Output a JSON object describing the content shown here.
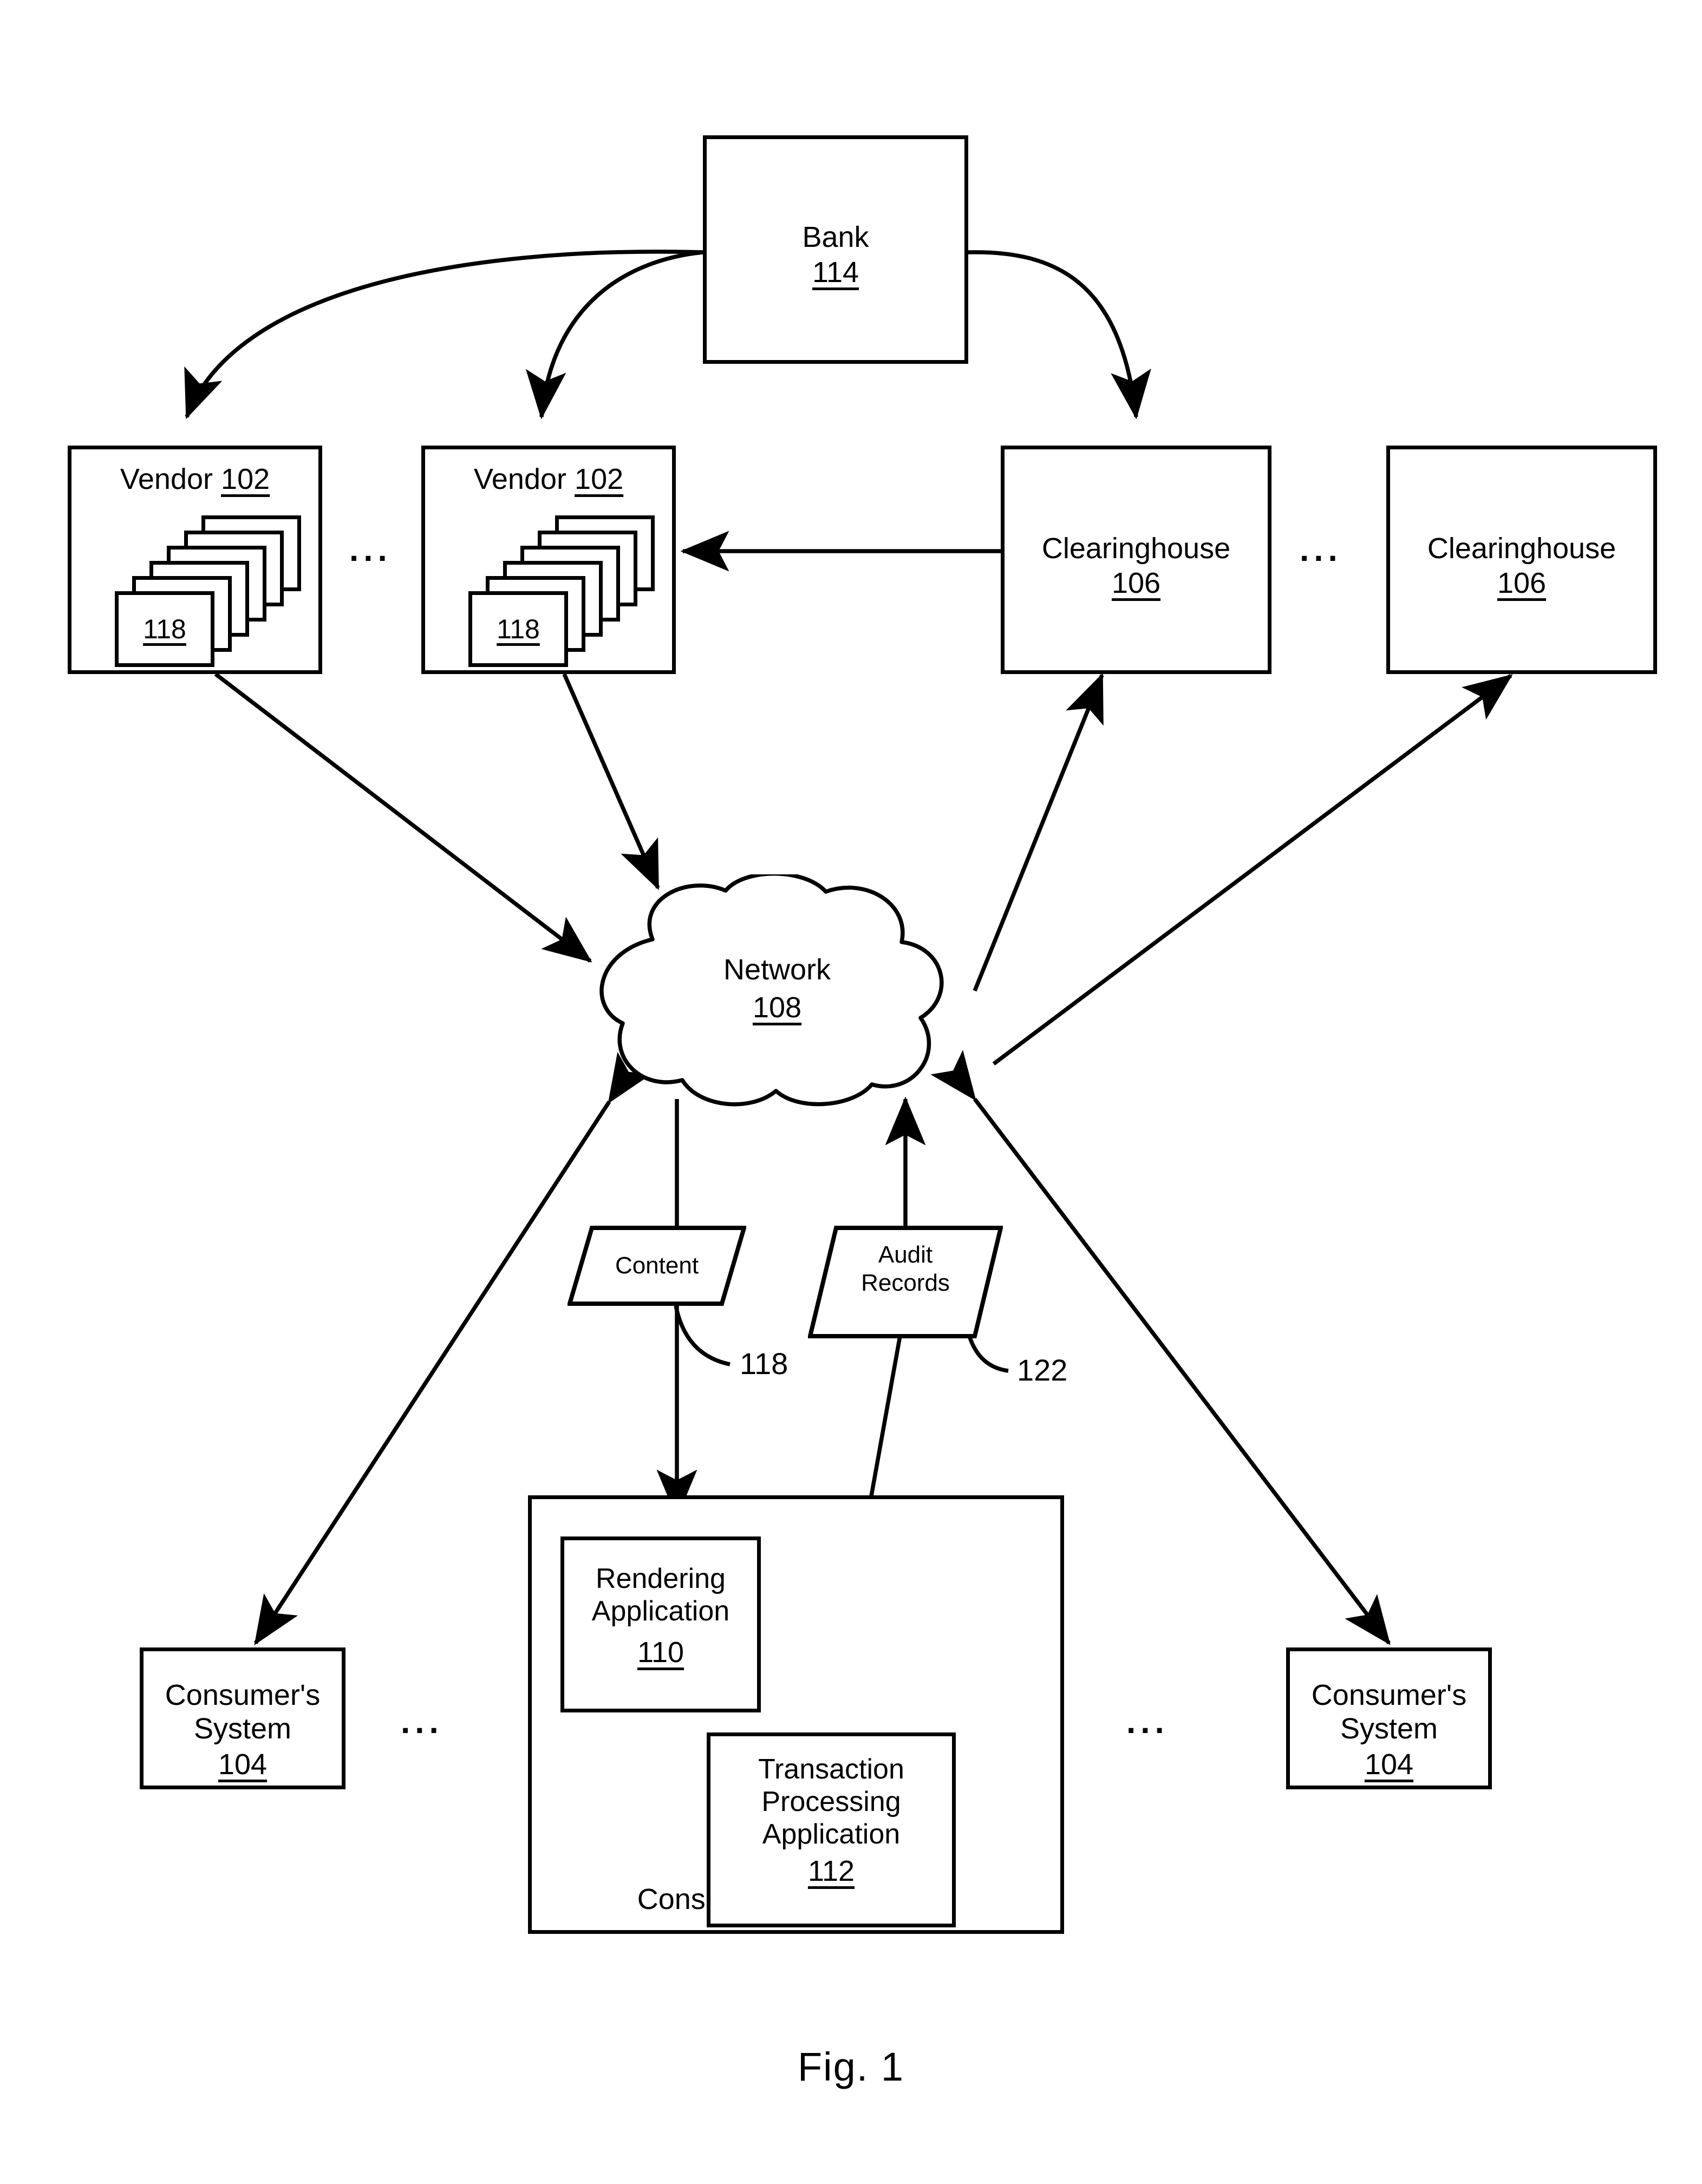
{
  "figure": {
    "caption": "Fig. 1"
  },
  "nodes": {
    "bank": {
      "title": "Bank",
      "ref": "114"
    },
    "vendor_1": {
      "title": "Vendor",
      "ref": "102",
      "card_ref": "118"
    },
    "vendor_2": {
      "title": "Vendor",
      "ref": "102",
      "card_ref": "118"
    },
    "clearinghouse_1": {
      "title": "Clearinghouse",
      "ref": "106"
    },
    "clearinghouse_2": {
      "title": "Clearinghouse",
      "ref": "106"
    },
    "network": {
      "title": "Network",
      "ref": "108"
    },
    "consumer_left": {
      "title_line1": "Consumer's",
      "title_line2": "System",
      "ref": "104"
    },
    "consumer_right": {
      "title_line1": "Consumer's",
      "title_line2": "System",
      "ref": "104"
    },
    "consumer_detail": {
      "title": "Consumer's System",
      "ref": "104"
    },
    "rendering_app": {
      "title_line1": "Rendering",
      "title_line2": "Application",
      "ref": "110"
    },
    "transaction_app": {
      "title_line1": "Transaction",
      "title_line2": "Processing",
      "title_line3": "Application",
      "ref": "112"
    }
  },
  "data_objects": {
    "content": {
      "label": "Content",
      "leader_ref": "118"
    },
    "audit_records": {
      "label_line1": "Audit",
      "label_line2": "Records",
      "leader_ref": "122"
    }
  },
  "ellipses": {
    "between_vendors": "...",
    "between_clearinghouses": "...",
    "left_of_detail": "...",
    "right_of_detail": "..."
  },
  "colors": {
    "stroke": "#000000",
    "background": "#ffffff"
  }
}
